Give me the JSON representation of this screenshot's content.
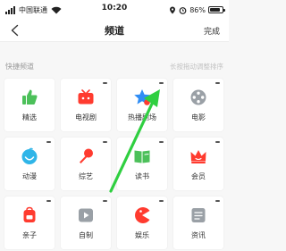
{
  "status_bar": {
    "carrier": "中国联通",
    "time": "10:20",
    "battery": "86%",
    "battery_level": 0.86
  },
  "nav": {
    "title": "频道",
    "done_label": "完成"
  },
  "section": {
    "title": "快捷频道",
    "hint": "长按拖动调整排序"
  },
  "channels": [
    {
      "label": "精选",
      "icon": "thumbs-up-icon",
      "color": "#4cc05a"
    },
    {
      "label": "电视剧",
      "icon": "tv-icon",
      "color": "#ff3b2f"
    },
    {
      "label": "热播剧场",
      "icon": "star-icon",
      "color": "#2f8df5"
    },
    {
      "label": "电影",
      "icon": "film-reel-icon",
      "color": "#9aa0a6"
    },
    {
      "label": "动漫",
      "icon": "cartoon-face-icon",
      "color": "#2fb5e8"
    },
    {
      "label": "综艺",
      "icon": "microphone-icon",
      "color": "#ff3b2f"
    },
    {
      "label": "读书",
      "icon": "book-icon",
      "color": "#4cc05a"
    },
    {
      "label": "会员",
      "icon": "crown-icon",
      "color": "#ff3b2f"
    },
    {
      "label": "亲子",
      "icon": "schoolbag-icon",
      "color": "#ff3b2f"
    },
    {
      "label": "自制",
      "icon": "play-box-icon",
      "color": "#9aa0a6"
    },
    {
      "label": "娱乐",
      "icon": "pacman-icon",
      "color": "#ff3b2f"
    },
    {
      "label": "资讯",
      "icon": "news-icon",
      "color": "#9aa0a6"
    }
  ],
  "annotation": {
    "arrow_color": "#2fcf40"
  }
}
